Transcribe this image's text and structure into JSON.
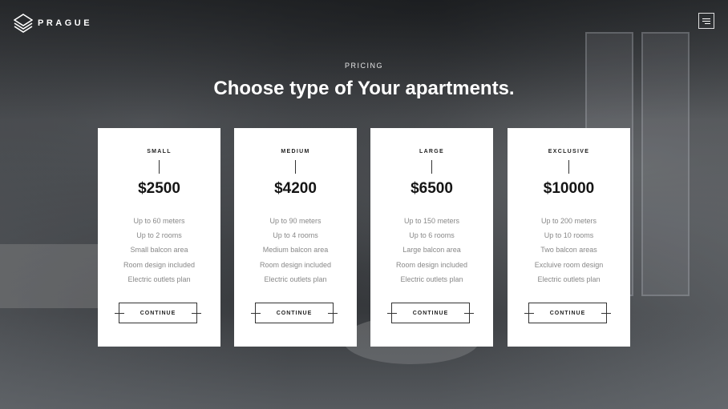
{
  "brand": {
    "name": "PRAGUE",
    "logo_icon": "stacked-diamond-logo"
  },
  "header": {
    "menu_icon": "hamburger-menu-icon"
  },
  "section": {
    "eyebrow": "PRICING",
    "title": "Choose type of Your apartments."
  },
  "plans": [
    {
      "name": "SMALL",
      "price": "$2500",
      "features": [
        "Up to 60 meters",
        "Up to 2 rooms",
        "Small balcon area",
        "Room design included",
        "Electric outlets plan"
      ],
      "button": "CONTINUE"
    },
    {
      "name": "MEDIUM",
      "price": "$4200",
      "features": [
        "Up to 90 meters",
        "Up to 4 rooms",
        "Medium balcon area",
        "Room design included",
        "Electric outlets plan"
      ],
      "button": "CONTINUE"
    },
    {
      "name": "LARGE",
      "price": "$6500",
      "features": [
        "Up to 150 meters",
        "Up to 6 rooms",
        "Large balcon area",
        "Room design included",
        "Electric outlets plan"
      ],
      "button": "CONTINUE"
    },
    {
      "name": "EXCLUSIVE",
      "price": "$10000",
      "features": [
        "Up to 200 meters",
        "Up to 10 rooms",
        "Two balcon areas",
        "Excluive room design",
        "Electric outlets plan"
      ],
      "button": "CONTINUE"
    }
  ]
}
